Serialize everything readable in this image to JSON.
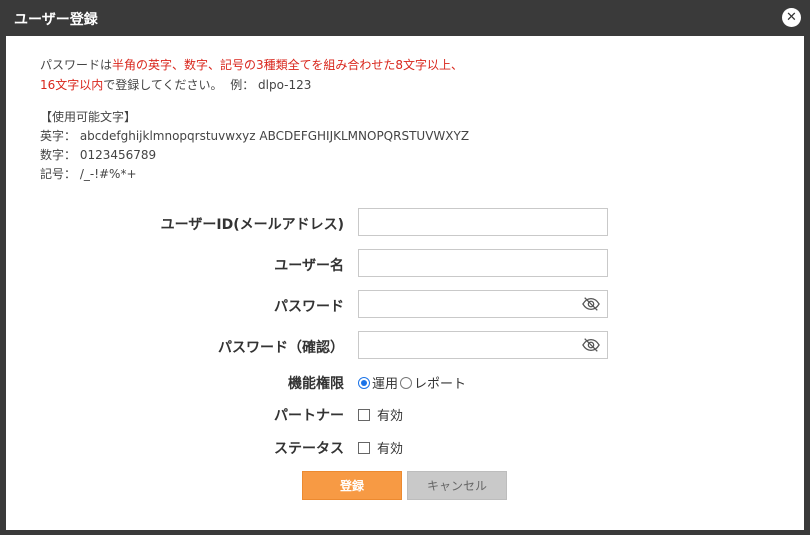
{
  "dialog": {
    "title": "ユーザー登録",
    "close_glyph": "✕"
  },
  "notice": {
    "line1_a": "パスワードは",
    "line1_b": "半角の英字、数字、記号の3種類全てを組み合わせた8文字以上、",
    "line2_a": "16文字以内",
    "line2_b": "で登録してください。",
    "line2_c": "例： dlpo-123"
  },
  "allowed_chars": {
    "heading": "【使用可能文字】",
    "letters": "英字： abcdefghijklmnopqrstuvwxyz ABCDEFGHIJKLMNOPQRSTUVWXYZ",
    "digits": "数字： 0123456789",
    "symbols": "記号： /_-!#%*+"
  },
  "form": {
    "user_id_label": "ユーザーID(メールアドレス)",
    "user_id_value": "",
    "user_name_label": "ユーザー名",
    "user_name_value": "",
    "password_label": "パスワード",
    "password_value": "",
    "password_confirm_label": "パスワード（確認）",
    "password_confirm_value": "",
    "permission_label": "機能権限",
    "permission_options": [
      "運用",
      "レポート"
    ],
    "permission_selected": "運用",
    "partner_label": "パートナー",
    "partner_checkbox_label": "有効",
    "status_label": "ステータス",
    "status_checkbox_label": "有効"
  },
  "buttons": {
    "register": "登録",
    "cancel": "キャンセル"
  },
  "colors": {
    "accent": "#f79a44",
    "warning_text": "#d9261c",
    "titlebar": "#3a3a3a"
  },
  "icons": {
    "close": "close-icon",
    "password_visibility": "eye-off-icon"
  }
}
